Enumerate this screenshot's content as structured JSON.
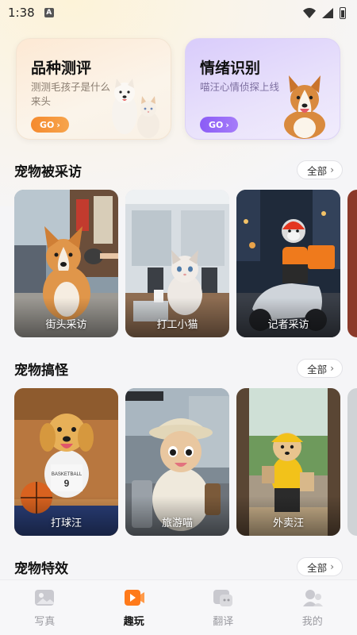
{
  "status_bar": {
    "time": "1:38",
    "notification_glyph": "A"
  },
  "feature_cards": [
    {
      "title": "品种测评",
      "subtitle": "测测毛孩子是什么来头",
      "go": "GO",
      "accent": "#f58a2e"
    },
    {
      "title": "情绪识别",
      "subtitle": "喵汪心情侦探上线",
      "go": "GO",
      "accent": "#8b5cf6"
    }
  ],
  "sections": [
    {
      "title": "宠物被采访",
      "all_label": "全部",
      "tiles": [
        {
          "label": "街头采访",
          "icon": "corgi-microphone"
        },
        {
          "label": "打工小猫",
          "icon": "cat-office"
        },
        {
          "label": "记者采访",
          "icon": "husky-delivery-scooter"
        }
      ]
    },
    {
      "title": "宠物搞怪",
      "all_label": "全部",
      "tiles": [
        {
          "label": "打球汪",
          "icon": "golden-basketball"
        },
        {
          "label": "旅游喵",
          "icon": "cat-travel-selfie"
        },
        {
          "label": "外卖汪",
          "icon": "puppy-food-delivery"
        }
      ]
    },
    {
      "title": "宠物特效",
      "all_label": "全部"
    }
  ],
  "bottom_nav": {
    "items": [
      {
        "label": "写真",
        "icon": "photo-icon",
        "active": false
      },
      {
        "label": "趣玩",
        "icon": "play-icon",
        "active": true
      },
      {
        "label": "翻译",
        "icon": "translate-icon",
        "active": false
      },
      {
        "label": "我的",
        "icon": "profile-icon",
        "active": false
      }
    ],
    "active_color": "#ff7a1a"
  }
}
